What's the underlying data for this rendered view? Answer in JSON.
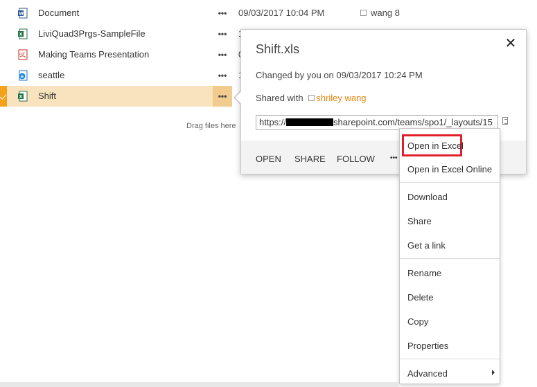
{
  "files": [
    {
      "name": "Document",
      "type": "word",
      "date": "09/03/2017 10:04 PM",
      "modified_by": "wang 8"
    },
    {
      "name": "LiviQuad3Prgs-SampleFile",
      "type": "excel",
      "date": "1",
      "modified_by": ""
    },
    {
      "name": "Making Teams Presentation",
      "type": "pdf",
      "date": "0",
      "modified_by": ""
    },
    {
      "name": "seattle",
      "type": "ie",
      "date": "1",
      "modified_by": ""
    },
    {
      "name": "Shift",
      "type": "excel",
      "date": "",
      "modified_by": ""
    }
  ],
  "list": {
    "dots": "•••",
    "drag_hint": "Drag files here"
  },
  "callout": {
    "title": "Shift.xls",
    "close": "✕",
    "changed": "Changed by you on 09/03/2017 10:24 PM",
    "shared_with_label": "Shared with",
    "shared_user": "shriley wang",
    "url_prefix": "https://",
    "url_suffix": "sharepoint.com/teams/spo1/_layouts/15",
    "actions": {
      "open": "OPEN",
      "share": "SHARE",
      "follow": "FOLLOW",
      "more": "•••"
    }
  },
  "menu": {
    "open_in_excel": "Open in Excel",
    "open_in_excel_online": "Open in Excel Online",
    "download": "Download",
    "share": "Share",
    "get_link": "Get a link",
    "rename": "Rename",
    "delete": "Delete",
    "copy": "Copy",
    "properties": "Properties",
    "advanced": "Advanced"
  },
  "colors": {
    "accent": "#f4a11c",
    "selected_row": "#f9e3bf",
    "shared_user": "#e8850c",
    "highlight_box": "#e0202a"
  }
}
